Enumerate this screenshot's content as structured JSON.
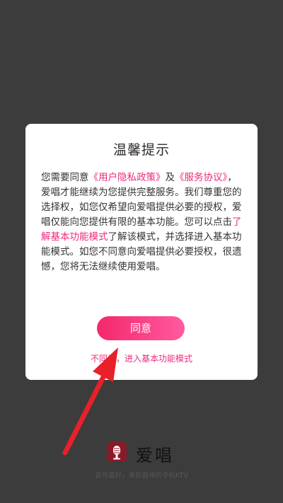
{
  "dialog": {
    "title": "温馨提示",
    "body": {
      "t1": "您需要同意",
      "privacy_link": "《用户隐私政策》",
      "t2": "及",
      "service_link": "《服务协议》",
      "t3": "，爱唱才能继续为您提供完整服务。我们尊重您的选择权，如您仅希望向爱唱提供必要的授权，爱唱仅能向您提供有限的基本功能。您可以点击",
      "basic_link": "了解基本功能模式",
      "t4": "了解该模式，并选择进入基本功能模式。如您不同意向爱唱提供必要授权，很遗憾，您将无法继续使用爱唱。"
    },
    "agree_button": "同意",
    "basic_mode_link": "不同意，进入基本功能模式"
  },
  "brand": {
    "app_name": "爱唱",
    "slogan": "音效最好，美颜最棒的手机KTV"
  },
  "colors": {
    "accent": "#ee2a7b",
    "button_gradient_start": "#f4286d",
    "button_gradient_end": "#ff5aa0",
    "overlay": "#3c3c3c",
    "annotation_arrow": "#e8202a"
  }
}
